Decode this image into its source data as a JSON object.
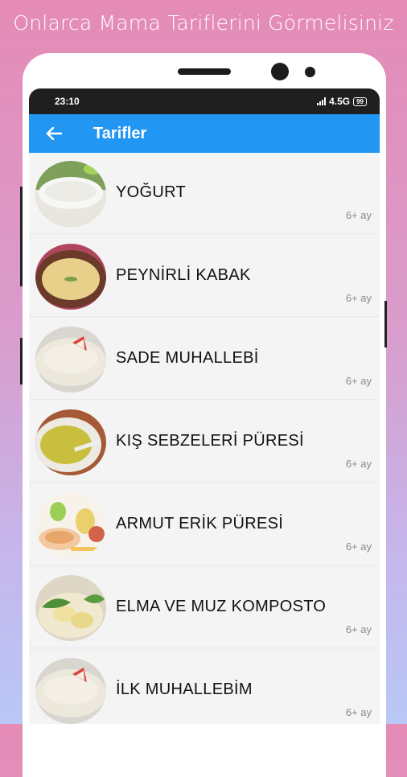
{
  "promo": {
    "headline": "Onlarca Mama Tariflerini Görmelisiniz"
  },
  "status_bar": {
    "time": "23:10",
    "network": "4.5G",
    "battery": "99"
  },
  "app_bar": {
    "title": "Tarifler",
    "back_icon": "arrow-left-icon"
  },
  "recipes": [
    {
      "name": "YOĞURT",
      "age": "6+ ay",
      "thumb": "yogurt-bowl"
    },
    {
      "name": "PEYNİRLİ KABAK",
      "age": "6+ ay",
      "thumb": "squash-soup"
    },
    {
      "name": "SADE MUHALLEBİ",
      "age": "6+ ay",
      "thumb": "pudding-apple"
    },
    {
      "name": "KIŞ SEBZELERİ PÜRESİ",
      "age": "6+ ay",
      "thumb": "green-puree"
    },
    {
      "name": "ARMUT ERİK PÜRESİ",
      "age": "6+ ay",
      "thumb": "pear-plum-puree"
    },
    {
      "name": "ELMA VE MUZ KOMPOSTO",
      "age": "6+ ay",
      "thumb": "apple-banana-compote"
    },
    {
      "name": "İLK MUHALLEBİM",
      "age": "6+ ay",
      "thumb": "pudding-apple"
    }
  ],
  "colors": {
    "app_bar": "#2196f3",
    "status_bar": "#1f1f1f",
    "background_top": "#e58bb6",
    "background_bottom": "#b9c8f7"
  }
}
